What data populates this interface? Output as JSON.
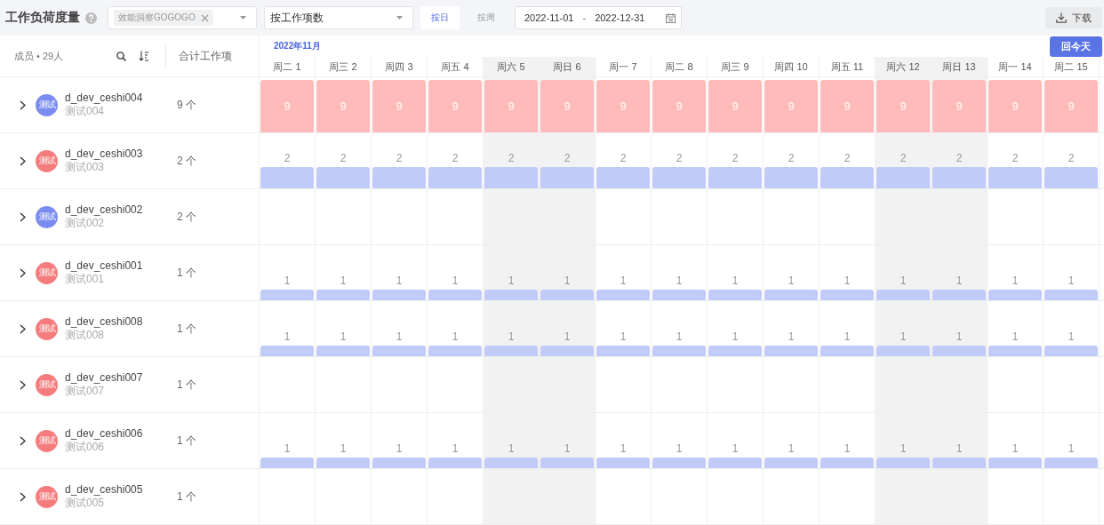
{
  "toolbar": {
    "title": "工作负荷度量",
    "project_select": {
      "tag": "效能洞察GOGOGO"
    },
    "metric_select": {
      "value": "按工作项数"
    },
    "granularity": [
      {
        "label": "按日",
        "selected": true
      },
      {
        "label": "按周",
        "selected": false
      }
    ],
    "date_range": {
      "start": "2022-11-01",
      "separator": "-",
      "end": "2022-12-31"
    },
    "download_button": "下载"
  },
  "members_header": {
    "label": "成员 • 29人",
    "total_label": "合计工作项"
  },
  "calendar": {
    "month": "2022年11月",
    "today_button": "回今天",
    "days": [
      {
        "label": "周二 1",
        "weekend": false
      },
      {
        "label": "周三 2",
        "weekend": false
      },
      {
        "label": "周四 3",
        "weekend": false
      },
      {
        "label": "周五 4",
        "weekend": false
      },
      {
        "label": "周六 5",
        "weekend": true
      },
      {
        "label": "周日 6",
        "weekend": true
      },
      {
        "label": "周一 7",
        "weekend": false
      },
      {
        "label": "周二 8",
        "weekend": false
      },
      {
        "label": "周三 9",
        "weekend": false
      },
      {
        "label": "周四 10",
        "weekend": false
      },
      {
        "label": "周五 11",
        "weekend": false
      },
      {
        "label": "周六 12",
        "weekend": true
      },
      {
        "label": "周日 13",
        "weekend": true
      },
      {
        "label": "周一 14",
        "weekend": false
      },
      {
        "label": "周二 15",
        "weekend": false
      }
    ]
  },
  "members": [
    {
      "name": "d_dev_ceshi004",
      "display_name": "测试004",
      "avatar": "测试",
      "color": "#7b8cf0",
      "total": "9 个",
      "kind": "over",
      "cells": [
        "9",
        "9",
        "9",
        "9",
        "9",
        "9",
        "9",
        "9",
        "9",
        "9",
        "9",
        "9",
        "9",
        "9",
        "9"
      ]
    },
    {
      "name": "d_dev_ceshi003",
      "display_name": "测试003",
      "avatar": "测试",
      "color": "#f47c7c",
      "total": "2 个",
      "kind": "medium",
      "cells": [
        "2",
        "2",
        "2",
        "2",
        "2",
        "2",
        "2",
        "2",
        "2",
        "2",
        "2",
        "2",
        "2",
        "2",
        "2"
      ]
    },
    {
      "name": "d_dev_ceshi002",
      "display_name": "测试002",
      "avatar": "测试",
      "color": "#7b8cf0",
      "total": "2 个"
    },
    {
      "name": "d_dev_ceshi001",
      "display_name": "测试001",
      "avatar": "测试",
      "color": "#f47c7c",
      "total": "1 个",
      "kind": "low",
      "cells": [
        "1",
        "1",
        "1",
        "1",
        "1",
        "1",
        "1",
        "1",
        "1",
        "1",
        "1",
        "1",
        "1",
        "1",
        "1"
      ]
    },
    {
      "name": "d_dev_ceshi008",
      "display_name": "测试008",
      "avatar": "测试",
      "color": "#f47c7c",
      "total": "1 个",
      "kind": "low",
      "cells": [
        "1",
        "1",
        "1",
        "1",
        "1",
        "1",
        "1",
        "1",
        "1",
        "1",
        "1",
        "1",
        "1",
        "1",
        "1"
      ]
    },
    {
      "name": "d_dev_ceshi007",
      "display_name": "测试007",
      "avatar": "测试",
      "color": "#f47c7c",
      "total": "1 个"
    },
    {
      "name": "d_dev_ceshi006",
      "display_name": "测试006",
      "avatar": "测试",
      "color": "#f47c7c",
      "total": "1 个",
      "kind": "low",
      "cells": [
        "1",
        "1",
        "1",
        "1",
        "1",
        "1",
        "1",
        "1",
        "1",
        "1",
        "1",
        "1",
        "1",
        "1",
        "1"
      ]
    },
    {
      "name": "d_dev_ceshi005",
      "display_name": "测试005",
      "avatar": "测试",
      "color": "#f47c7c",
      "total": "1 个"
    }
  ]
}
